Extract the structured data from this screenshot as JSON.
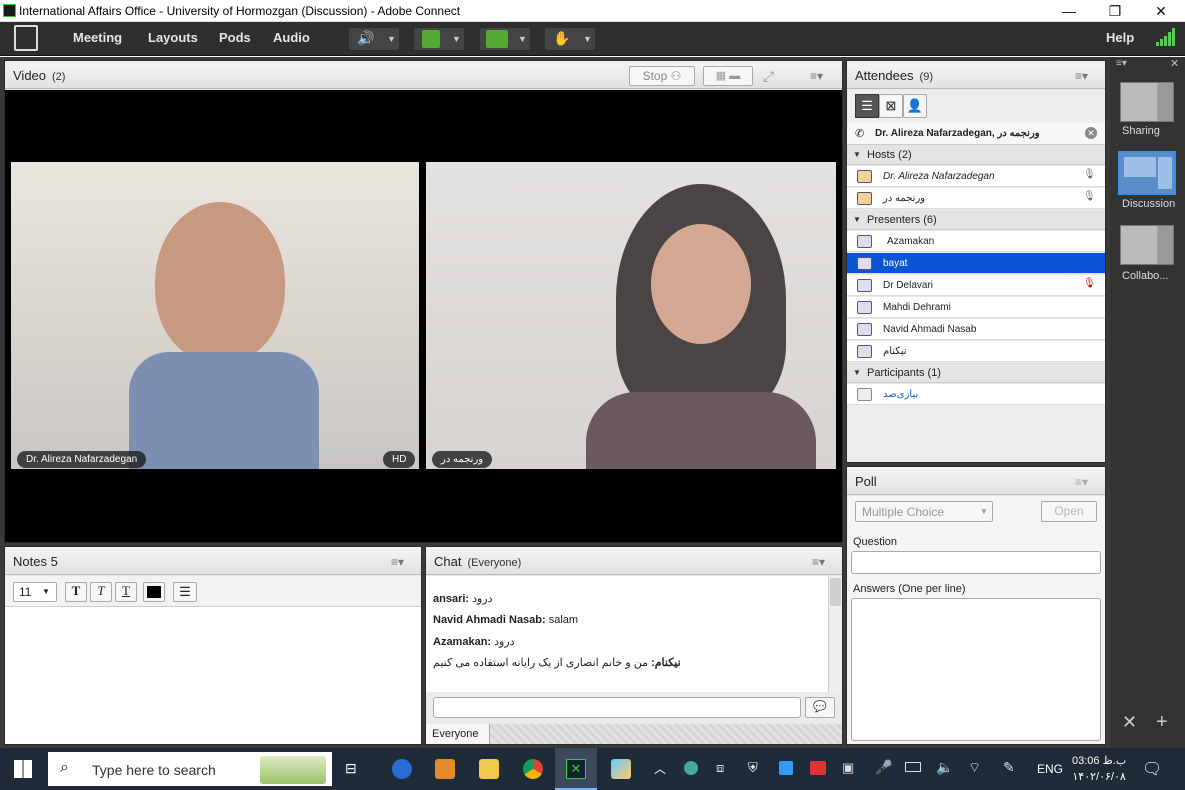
{
  "window": {
    "title": "International Affairs Office - University of Hormozgan (Discussion) - Adobe Connect",
    "minimize": "—",
    "maximize": "❐",
    "close": "✕"
  },
  "menubar": {
    "items": [
      "Meeting",
      "Layouts",
      "Pods",
      "Audio"
    ],
    "help": "Help"
  },
  "video_pod": {
    "title": "Video",
    "count": "(2)",
    "stop_label": "Stop",
    "feeds": [
      {
        "name": "Dr. Alireza Nafarzadegan",
        "badge": "HD"
      },
      {
        "name": "ورنجمه در"
      }
    ]
  },
  "notes_pod": {
    "title": "Notes 5",
    "font_size": "11"
  },
  "chat_pod": {
    "title": "Chat",
    "scope": "(Everyone)",
    "messages": [
      {
        "sender": "ansari:",
        "text": "درود"
      },
      {
        "sender": "Navid Ahmadi Nasab:",
        "text": "salam"
      },
      {
        "sender": "Azamakan:",
        "text": "درود"
      },
      {
        "sender": "نیکنام:",
        "text": "من و خانم انصاری از یک رایانه استفاده می کنیم"
      }
    ],
    "tab": "Everyone"
  },
  "attendees_pod": {
    "title": "Attendees",
    "count": "(9)",
    "selected_user": "Dr. Alireza Nafarzadegan, ورنجمه در",
    "groups": [
      {
        "label": "Hosts (2)",
        "members": [
          "Dr. Alireza Nafarzadegan",
          "ورنجمه در"
        ]
      },
      {
        "label": "Presenters (6)",
        "members": [
          "Azamakan",
          "bayat",
          "Dr Delavari",
          "Mahdi Dehrami",
          "Navid Ahmadi Nasab",
          "نیکنام"
        ]
      },
      {
        "label": "Participants (1)",
        "members": [
          "بیاری‌صد"
        ]
      }
    ],
    "highlighted": "bayat"
  },
  "poll_pod": {
    "title": "Poll",
    "type": "Multiple Choice",
    "open_label": "Open",
    "question_label": "Question",
    "answers_label": "Answers (One per line)"
  },
  "layouts": [
    {
      "label": "Sharing"
    },
    {
      "label": "Discussion"
    },
    {
      "label": "Collabo..."
    }
  ],
  "taskbar": {
    "search_placeholder": "Type here to search",
    "lang": "ENG",
    "time": "03:06 ب.ظ",
    "date": "۱۴۰۲/۰۶/۰۸"
  },
  "colors": {
    "menubar": "#2f2f2f",
    "selection": "#0a55d6",
    "stage": "#3a3a3a",
    "taskbar": "#1f2b38"
  }
}
